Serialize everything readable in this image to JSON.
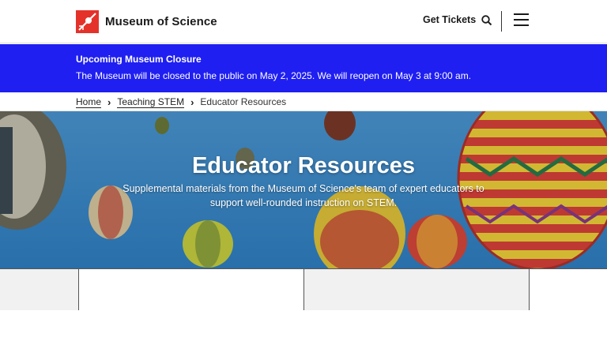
{
  "header": {
    "logo_text": "Museum of Science",
    "get_tickets_label": "Get Tickets"
  },
  "alert": {
    "title": "Upcoming Museum Closure",
    "text": "The Museum will be closed to the public on May 2, 2025. We will reopen on May 3 at 9:00 am."
  },
  "breadcrumb": {
    "items": [
      "Home",
      "Teaching STEM"
    ],
    "current": "Educator Resources"
  },
  "hero": {
    "title": "Educator Resources",
    "subtitle": "Supplemental materials from the Museum of Science's team of expert educators to support well-rounded instruction on STEM."
  },
  "colors": {
    "brand_red": "#e4322b",
    "alert_blue": "#1f1ff2",
    "sky_blue": "#3e8fcf"
  },
  "icons": [
    "logo-mark",
    "search-icon",
    "menu-icon",
    "chevron-right-icon"
  ]
}
